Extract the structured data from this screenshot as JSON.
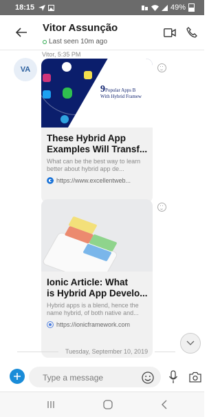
{
  "status": {
    "time": "18:15",
    "battery": "49%"
  },
  "header": {
    "back_icon": "arrow-left-icon",
    "contact_name": "Vitor Assunção",
    "presence": "Last seen 10m ago"
  },
  "chat": {
    "avatar_initials": "VA",
    "message_meta": "Vitor, 5:35 PM",
    "cards": [
      {
        "image_title_top": "9",
        "image_title_rest": "Popular Apps B",
        "image_title_line2": "With Hybrid Framew",
        "title": "These Hybrid App Examples Will Transf...",
        "title_line1": "These Hybrid App",
        "title_line2": "Examples Will Transf...",
        "description": "What can be the best way to learn better about hybrid app de...",
        "url": "https://www.excellentweb..."
      },
      {
        "title_line1": "Ionic Article: What",
        "title_line2": "is Hybrid App Develo...",
        "description": "Hybrid apps is a blend, hence the name hybrid, of both native and...",
        "url": "https://ionicframework.com"
      }
    ],
    "date_separator": "Tuesday, September 10, 2019"
  },
  "composer": {
    "placeholder": "Type a message"
  },
  "colors": {
    "accent": "#1a8cd8",
    "online": "#2aa84a",
    "banner_navy": "#0b1e6c"
  }
}
